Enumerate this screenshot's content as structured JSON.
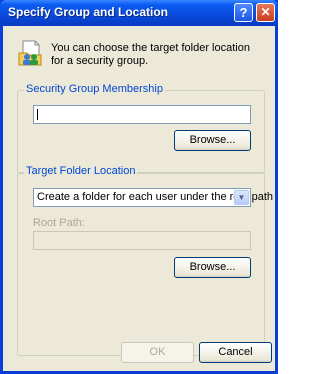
{
  "dialog": {
    "title": "Specify Group and Location",
    "help_label": "?",
    "close_label": "✕",
    "info_text": "You can choose the target folder location for a security group."
  },
  "membership": {
    "legend": "Security Group Membership",
    "value": "",
    "browse_label": "Browse..."
  },
  "location": {
    "legend": "Target Folder Location",
    "selected_option": "Create a folder for each user under the root path",
    "root_path_label": "Root Path:",
    "root_path_value": "",
    "browse_label": "Browse..."
  },
  "footer": {
    "ok_label": "OK",
    "cancel_label": "Cancel"
  }
}
